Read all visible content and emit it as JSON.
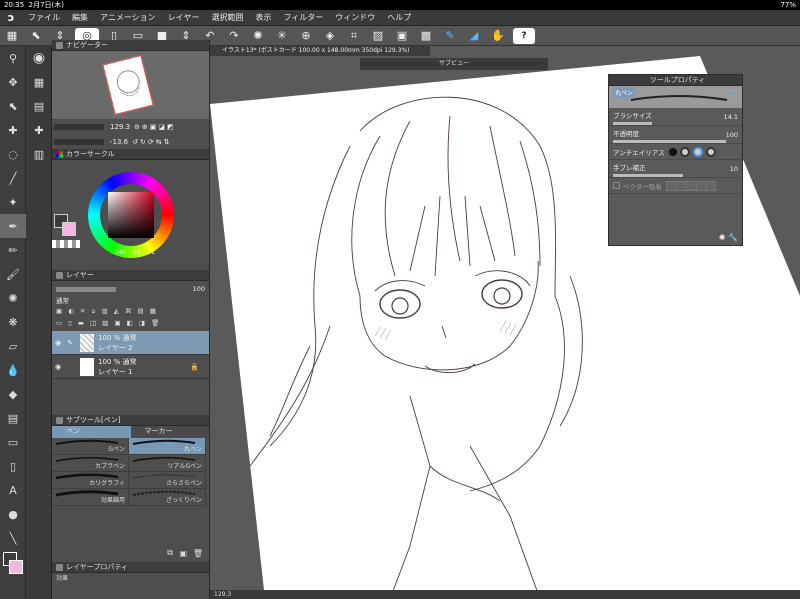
{
  "status": {
    "time": "20:35",
    "date": "2月7日(木)",
    "battery": "77%"
  },
  "menu": [
    "ファイル",
    "編集",
    "アニメーション",
    "レイヤー",
    "選択範囲",
    "表示",
    "フィルター",
    "ウィンドウ",
    "ヘルプ"
  ],
  "document": {
    "tab_title": "イラスト13* (ポストカード 100.00 x 148.00mm 350dpi 129.3%)"
  },
  "navigator": {
    "title": "ナビゲーター",
    "zoom": "129.3",
    "angle": "-13.6"
  },
  "color_circle": {
    "title": "カラーサークル",
    "h": "348",
    "s": "21",
    "v": "31"
  },
  "layers": {
    "title": "レイヤー",
    "blend_mode": "通常",
    "opacity": "100",
    "items": [
      {
        "opacity": "100 %",
        "mode": "通常",
        "name": "レイヤー 2"
      },
      {
        "opacity": "100 %",
        "mode": "通常",
        "name": "レイヤー 1"
      }
    ]
  },
  "subtool": {
    "title": "サブツール[ペン]",
    "tabs": [
      "ペン",
      "マーカー"
    ],
    "brushes": [
      "Gペン",
      "丸ペン",
      "カブラペン",
      "リアルGペン",
      "カリグラフィ",
      "さらさらペン",
      "効果線用",
      "ざっくりペン"
    ]
  },
  "layer_prop": {
    "title": "レイヤープロパティ",
    "effect_label": "効果"
  },
  "subview": {
    "title": "サブビュー"
  },
  "tool_property": {
    "title": "ツールプロパティ",
    "tool_name": "丸ペン",
    "brush_size_label": "ブラシサイズ",
    "brush_size": "14.1",
    "opacity_label": "不透明度",
    "opacity": "100",
    "antialias_label": "アンチエイリアス",
    "stabilization_label": "手ブレ補正",
    "stabilization": "10",
    "vector_label": "ベクター吸着"
  },
  "bottom": {
    "zoom": "129.3"
  },
  "colors": {
    "main": "#3a3a3a",
    "sub": "#f2b6e0",
    "accent": "#4a9fe8"
  }
}
